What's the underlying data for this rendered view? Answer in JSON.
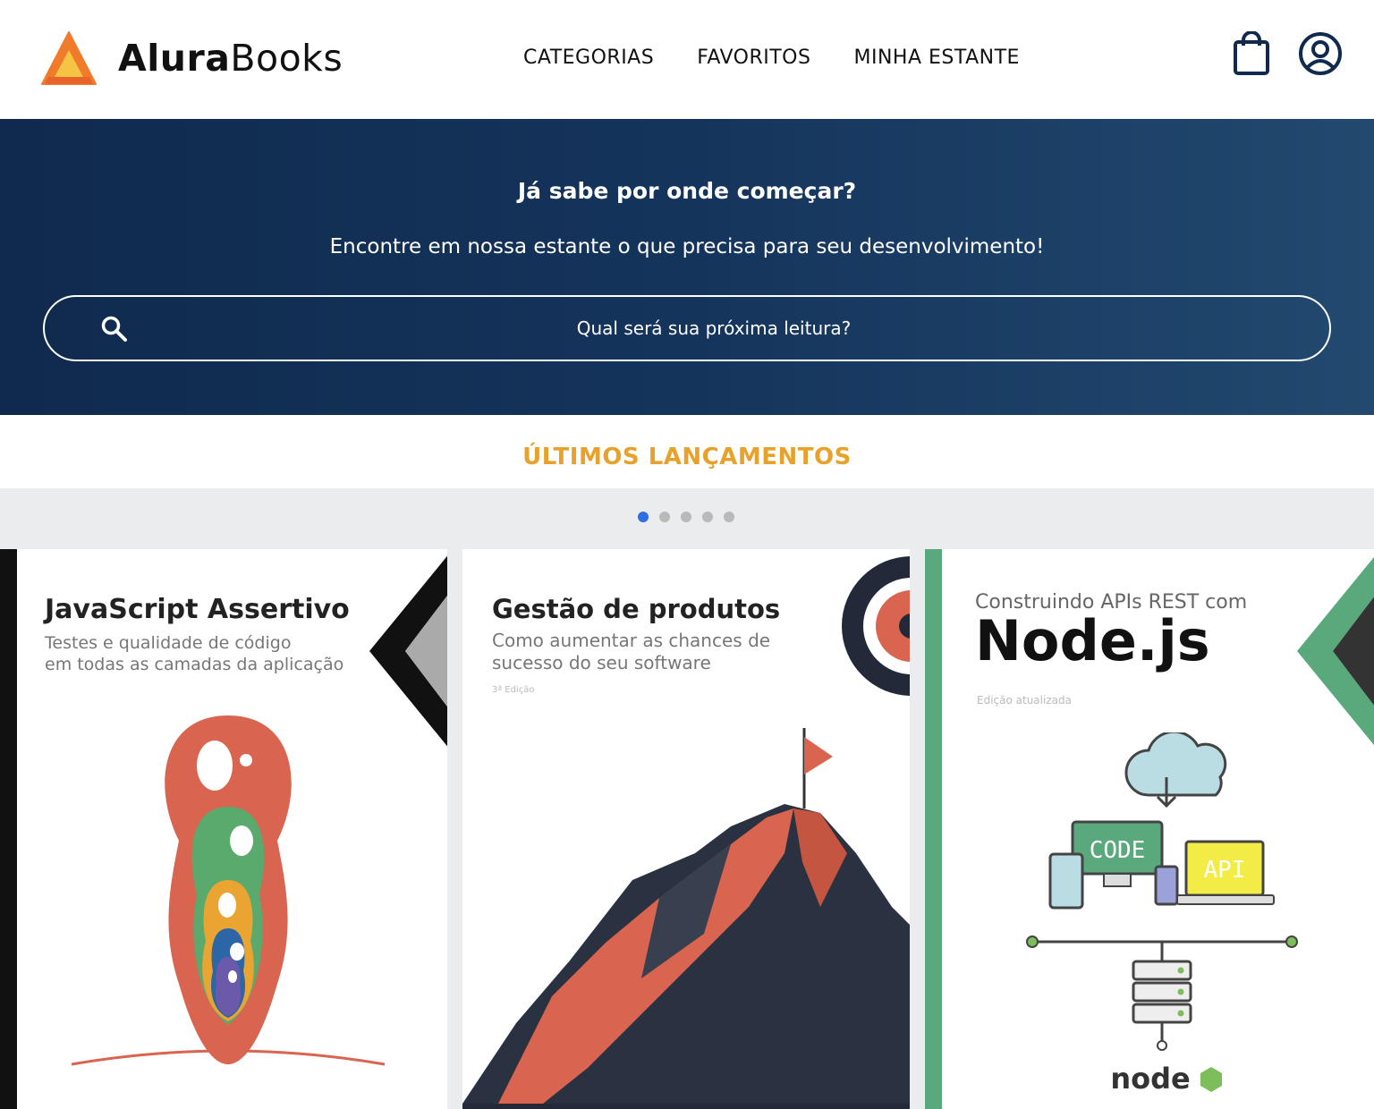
{
  "brand": {
    "name_bold": "Alura",
    "name_regular": "Books"
  },
  "nav": {
    "items": [
      "CATEGORIAS",
      "FAVORITOS",
      "MINHA ESTANTE"
    ]
  },
  "hero": {
    "title": "Já sabe por onde começar?",
    "subtitle": "Encontre em nossa estante o que precisa para seu desenvolvimento!",
    "search_placeholder": "Qual será sua próxima leitura?"
  },
  "section": {
    "title": "ÚLTIMOS LANÇAMENTOS"
  },
  "carousel": {
    "dot_count": 5,
    "active_dot": 0
  },
  "books": [
    {
      "title": "JavaScript Assertivo",
      "subtitle_line1": "Testes e qualidade de código",
      "subtitle_line2": "em todas as camadas da aplicação"
    },
    {
      "title": "Gestão de produtos",
      "subtitle_line1": "Como aumentar as chances de",
      "subtitle_line2": "sucesso do seu software",
      "edition": "3ª Edição"
    },
    {
      "title_pre": "Construindo APIs REST com",
      "title": "Node.js",
      "edition": "Edição atualizada",
      "label_code": "CODE",
      "label_api": "API",
      "logo_text": "node"
    }
  ],
  "colors": {
    "hero_start": "#0f2a4d",
    "hero_end": "#22496f",
    "accent": "#e8a22c",
    "dot_active": "#2f6fe3",
    "dot_inactive": "#b9b9b9",
    "logo_orange": "#f07b2a",
    "logo_yellow": "#f6c445"
  },
  "icons": [
    "shopping-bag-icon",
    "user-profile-icon",
    "search-icon"
  ]
}
